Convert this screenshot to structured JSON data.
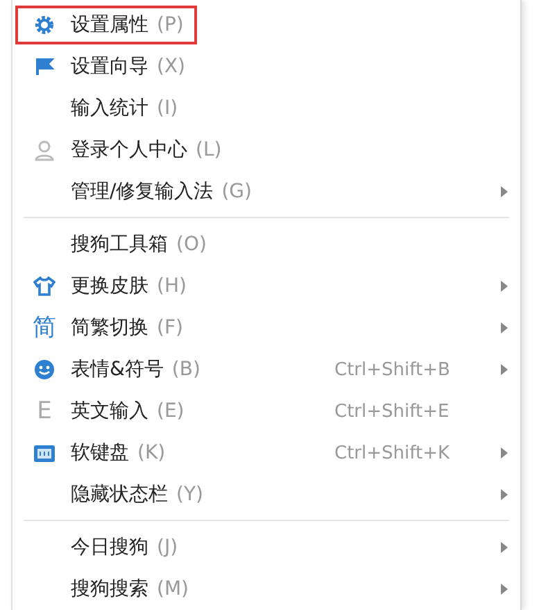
{
  "menu": {
    "groups": [
      {
        "items": [
          {
            "label": "设置属性",
            "key": "(P)",
            "highlighted": true,
            "submenu": false
          },
          {
            "label": "设置向导",
            "key": "(X)",
            "highlighted": false,
            "submenu": false
          },
          {
            "label": "输入统计",
            "key": "(I)",
            "highlighted": false,
            "submenu": false
          },
          {
            "label": "登录个人中心",
            "key": "(L)",
            "highlighted": false,
            "submenu": false
          },
          {
            "label": "管理/修复输入法",
            "key": "(G)",
            "highlighted": false,
            "submenu": true
          }
        ]
      },
      {
        "items": [
          {
            "label": "搜狗工具箱",
            "key": "(O)",
            "highlighted": false,
            "submenu": false
          },
          {
            "label": "更换皮肤",
            "key": "(H)",
            "highlighted": false,
            "submenu": true
          },
          {
            "label": "简繁切换",
            "key": "(F)",
            "highlighted": false,
            "submenu": true,
            "glyph": "简"
          },
          {
            "label": "表情&符号",
            "key": "(B)",
            "shortcut": "Ctrl+Shift+B",
            "highlighted": false,
            "submenu": true
          },
          {
            "label": "英文输入",
            "key": "(E)",
            "shortcut": "Ctrl+Shift+E",
            "highlighted": false,
            "submenu": false,
            "glyph": "E"
          },
          {
            "label": "软键盘",
            "key": "(K)",
            "shortcut": "Ctrl+Shift+K",
            "highlighted": false,
            "submenu": true
          },
          {
            "label": "隐藏状态栏",
            "key": "(Y)",
            "highlighted": false,
            "submenu": true
          }
        ]
      },
      {
        "items": [
          {
            "label": "今日搜狗",
            "key": "(J)",
            "highlighted": false,
            "submenu": true
          },
          {
            "label": "搜狗搜索",
            "key": "(M)",
            "highlighted": false,
            "submenu": true
          }
        ]
      }
    ]
  }
}
